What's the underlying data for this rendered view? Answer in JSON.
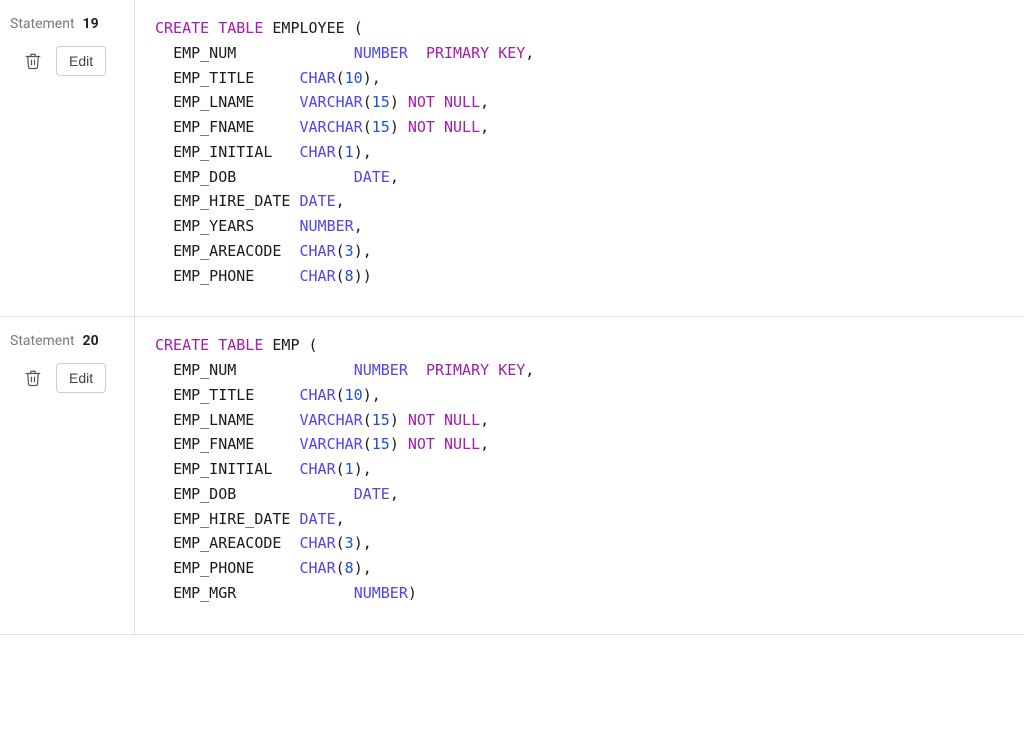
{
  "labels": {
    "statement": "Statement",
    "edit": "Edit"
  },
  "statements": [
    {
      "number": "19",
      "tokens": [
        {
          "t": "kw",
          "v": "CREATE"
        },
        {
          "t": "sp",
          "v": " "
        },
        {
          "t": "kw",
          "v": "TABLE"
        },
        {
          "t": "sp",
          "v": " "
        },
        {
          "t": "id",
          "v": "EMPLOYEE"
        },
        {
          "t": "sp",
          "v": " "
        },
        {
          "t": "pn",
          "v": "("
        },
        {
          "t": "nl"
        },
        {
          "t": "sp",
          "v": "  "
        },
        {
          "t": "id",
          "v": "EMP_NUM"
        },
        {
          "t": "sp",
          "v": "             "
        },
        {
          "t": "ty",
          "v": "NUMBER"
        },
        {
          "t": "sp",
          "v": "  "
        },
        {
          "t": "kw",
          "v": "PRIMARY"
        },
        {
          "t": "sp",
          "v": " "
        },
        {
          "t": "kw",
          "v": "KEY"
        },
        {
          "t": "pn",
          "v": ","
        },
        {
          "t": "nl"
        },
        {
          "t": "sp",
          "v": "  "
        },
        {
          "t": "id",
          "v": "EMP_TITLE"
        },
        {
          "t": "sp",
          "v": "     "
        },
        {
          "t": "ty",
          "v": "CHAR"
        },
        {
          "t": "pn",
          "v": "("
        },
        {
          "t": "num",
          "v": "10"
        },
        {
          "t": "pn",
          "v": ")"
        },
        {
          "t": "pn",
          "v": ","
        },
        {
          "t": "nl"
        },
        {
          "t": "sp",
          "v": "  "
        },
        {
          "t": "id",
          "v": "EMP_LNAME"
        },
        {
          "t": "sp",
          "v": "     "
        },
        {
          "t": "ty",
          "v": "VARCHAR"
        },
        {
          "t": "pn",
          "v": "("
        },
        {
          "t": "num",
          "v": "15"
        },
        {
          "t": "pn",
          "v": ")"
        },
        {
          "t": "sp",
          "v": " "
        },
        {
          "t": "kw",
          "v": "NOT"
        },
        {
          "t": "sp",
          "v": " "
        },
        {
          "t": "kw",
          "v": "NULL"
        },
        {
          "t": "pn",
          "v": ","
        },
        {
          "t": "nl"
        },
        {
          "t": "sp",
          "v": "  "
        },
        {
          "t": "id",
          "v": "EMP_FNAME"
        },
        {
          "t": "sp",
          "v": "     "
        },
        {
          "t": "ty",
          "v": "VARCHAR"
        },
        {
          "t": "pn",
          "v": "("
        },
        {
          "t": "num",
          "v": "15"
        },
        {
          "t": "pn",
          "v": ")"
        },
        {
          "t": "sp",
          "v": " "
        },
        {
          "t": "kw",
          "v": "NOT"
        },
        {
          "t": "sp",
          "v": " "
        },
        {
          "t": "kw",
          "v": "NULL"
        },
        {
          "t": "pn",
          "v": ","
        },
        {
          "t": "nl"
        },
        {
          "t": "sp",
          "v": "  "
        },
        {
          "t": "id",
          "v": "EMP_INITIAL"
        },
        {
          "t": "sp",
          "v": "   "
        },
        {
          "t": "ty",
          "v": "CHAR"
        },
        {
          "t": "pn",
          "v": "("
        },
        {
          "t": "num",
          "v": "1"
        },
        {
          "t": "pn",
          "v": ")"
        },
        {
          "t": "pn",
          "v": ","
        },
        {
          "t": "nl"
        },
        {
          "t": "sp",
          "v": "  "
        },
        {
          "t": "id",
          "v": "EMP_DOB"
        },
        {
          "t": "sp",
          "v": "             "
        },
        {
          "t": "ty",
          "v": "DATE"
        },
        {
          "t": "pn",
          "v": ","
        },
        {
          "t": "nl"
        },
        {
          "t": "sp",
          "v": "  "
        },
        {
          "t": "id",
          "v": "EMP_HIRE_DATE"
        },
        {
          "t": "sp",
          "v": " "
        },
        {
          "t": "ty",
          "v": "DATE"
        },
        {
          "t": "pn",
          "v": ","
        },
        {
          "t": "nl"
        },
        {
          "t": "sp",
          "v": "  "
        },
        {
          "t": "id",
          "v": "EMP_YEARS"
        },
        {
          "t": "sp",
          "v": "     "
        },
        {
          "t": "ty",
          "v": "NUMBER"
        },
        {
          "t": "pn",
          "v": ","
        },
        {
          "t": "nl"
        },
        {
          "t": "sp",
          "v": "  "
        },
        {
          "t": "id",
          "v": "EMP_AREACODE"
        },
        {
          "t": "sp",
          "v": "  "
        },
        {
          "t": "ty",
          "v": "CHAR"
        },
        {
          "t": "pn",
          "v": "("
        },
        {
          "t": "num",
          "v": "3"
        },
        {
          "t": "pn",
          "v": ")"
        },
        {
          "t": "pn",
          "v": ","
        },
        {
          "t": "nl"
        },
        {
          "t": "sp",
          "v": "  "
        },
        {
          "t": "id",
          "v": "EMP_PHONE"
        },
        {
          "t": "sp",
          "v": "     "
        },
        {
          "t": "ty",
          "v": "CHAR"
        },
        {
          "t": "pn",
          "v": "("
        },
        {
          "t": "num",
          "v": "8"
        },
        {
          "t": "pn",
          "v": ")"
        },
        {
          "t": "pn",
          "v": ")"
        }
      ]
    },
    {
      "number": "20",
      "tokens": [
        {
          "t": "kw",
          "v": "CREATE"
        },
        {
          "t": "sp",
          "v": " "
        },
        {
          "t": "kw",
          "v": "TABLE"
        },
        {
          "t": "sp",
          "v": " "
        },
        {
          "t": "id",
          "v": "EMP"
        },
        {
          "t": "sp",
          "v": " "
        },
        {
          "t": "pn",
          "v": "("
        },
        {
          "t": "nl"
        },
        {
          "t": "sp",
          "v": "  "
        },
        {
          "t": "id",
          "v": "EMP_NUM"
        },
        {
          "t": "sp",
          "v": "             "
        },
        {
          "t": "ty",
          "v": "NUMBER"
        },
        {
          "t": "sp",
          "v": "  "
        },
        {
          "t": "kw",
          "v": "PRIMARY"
        },
        {
          "t": "sp",
          "v": " "
        },
        {
          "t": "kw",
          "v": "KEY"
        },
        {
          "t": "pn",
          "v": ","
        },
        {
          "t": "nl"
        },
        {
          "t": "sp",
          "v": "  "
        },
        {
          "t": "id",
          "v": "EMP_TITLE"
        },
        {
          "t": "sp",
          "v": "     "
        },
        {
          "t": "ty",
          "v": "CHAR"
        },
        {
          "t": "pn",
          "v": "("
        },
        {
          "t": "num",
          "v": "10"
        },
        {
          "t": "pn",
          "v": ")"
        },
        {
          "t": "pn",
          "v": ","
        },
        {
          "t": "nl"
        },
        {
          "t": "sp",
          "v": "  "
        },
        {
          "t": "id",
          "v": "EMP_LNAME"
        },
        {
          "t": "sp",
          "v": "     "
        },
        {
          "t": "ty",
          "v": "VARCHAR"
        },
        {
          "t": "pn",
          "v": "("
        },
        {
          "t": "num",
          "v": "15"
        },
        {
          "t": "pn",
          "v": ")"
        },
        {
          "t": "sp",
          "v": " "
        },
        {
          "t": "kw",
          "v": "NOT"
        },
        {
          "t": "sp",
          "v": " "
        },
        {
          "t": "kw",
          "v": "NULL"
        },
        {
          "t": "pn",
          "v": ","
        },
        {
          "t": "nl"
        },
        {
          "t": "sp",
          "v": "  "
        },
        {
          "t": "id",
          "v": "EMP_FNAME"
        },
        {
          "t": "sp",
          "v": "     "
        },
        {
          "t": "ty",
          "v": "VARCHAR"
        },
        {
          "t": "pn",
          "v": "("
        },
        {
          "t": "num",
          "v": "15"
        },
        {
          "t": "pn",
          "v": ")"
        },
        {
          "t": "sp",
          "v": " "
        },
        {
          "t": "kw",
          "v": "NOT"
        },
        {
          "t": "sp",
          "v": " "
        },
        {
          "t": "kw",
          "v": "NULL"
        },
        {
          "t": "pn",
          "v": ","
        },
        {
          "t": "nl"
        },
        {
          "t": "sp",
          "v": "  "
        },
        {
          "t": "id",
          "v": "EMP_INITIAL"
        },
        {
          "t": "sp",
          "v": "   "
        },
        {
          "t": "ty",
          "v": "CHAR"
        },
        {
          "t": "pn",
          "v": "("
        },
        {
          "t": "num",
          "v": "1"
        },
        {
          "t": "pn",
          "v": ")"
        },
        {
          "t": "pn",
          "v": ","
        },
        {
          "t": "nl"
        },
        {
          "t": "sp",
          "v": "  "
        },
        {
          "t": "id",
          "v": "EMP_DOB"
        },
        {
          "t": "sp",
          "v": "             "
        },
        {
          "t": "ty",
          "v": "DATE"
        },
        {
          "t": "pn",
          "v": ","
        },
        {
          "t": "nl"
        },
        {
          "t": "sp",
          "v": "  "
        },
        {
          "t": "id",
          "v": "EMP_HIRE_DATE"
        },
        {
          "t": "sp",
          "v": " "
        },
        {
          "t": "ty",
          "v": "DATE"
        },
        {
          "t": "pn",
          "v": ","
        },
        {
          "t": "nl"
        },
        {
          "t": "sp",
          "v": "  "
        },
        {
          "t": "id",
          "v": "EMP_AREACODE"
        },
        {
          "t": "sp",
          "v": "  "
        },
        {
          "t": "ty",
          "v": "CHAR"
        },
        {
          "t": "pn",
          "v": "("
        },
        {
          "t": "num",
          "v": "3"
        },
        {
          "t": "pn",
          "v": ")"
        },
        {
          "t": "pn",
          "v": ","
        },
        {
          "t": "nl"
        },
        {
          "t": "sp",
          "v": "  "
        },
        {
          "t": "id",
          "v": "EMP_PHONE"
        },
        {
          "t": "sp",
          "v": "     "
        },
        {
          "t": "ty",
          "v": "CHAR"
        },
        {
          "t": "pn",
          "v": "("
        },
        {
          "t": "num",
          "v": "8"
        },
        {
          "t": "pn",
          "v": ")"
        },
        {
          "t": "pn",
          "v": ","
        },
        {
          "t": "nl"
        },
        {
          "t": "sp",
          "v": "  "
        },
        {
          "t": "id",
          "v": "EMP_MGR"
        },
        {
          "t": "sp",
          "v": "             "
        },
        {
          "t": "ty",
          "v": "NUMBER"
        },
        {
          "t": "pn",
          "v": ")"
        }
      ]
    }
  ]
}
